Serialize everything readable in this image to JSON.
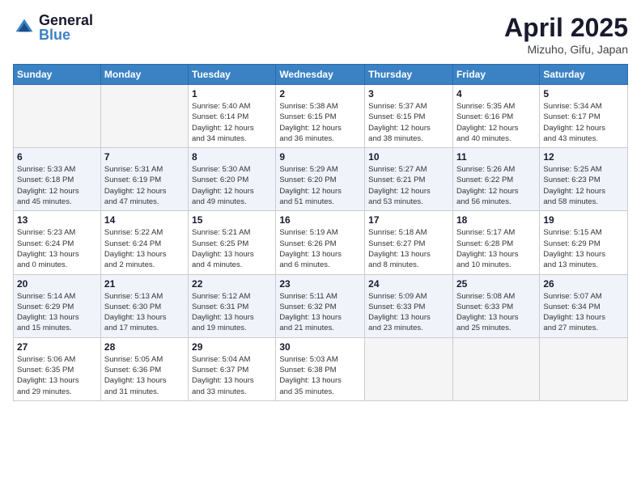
{
  "logo": {
    "general": "General",
    "blue": "Blue"
  },
  "title": "April 2025",
  "location": "Mizuho, Gifu, Japan",
  "weekdays": [
    "Sunday",
    "Monday",
    "Tuesday",
    "Wednesday",
    "Thursday",
    "Friday",
    "Saturday"
  ],
  "weeks": [
    [
      {
        "day": "",
        "info": ""
      },
      {
        "day": "",
        "info": ""
      },
      {
        "day": "1",
        "info": "Sunrise: 5:40 AM\nSunset: 6:14 PM\nDaylight: 12 hours\nand 34 minutes."
      },
      {
        "day": "2",
        "info": "Sunrise: 5:38 AM\nSunset: 6:15 PM\nDaylight: 12 hours\nand 36 minutes."
      },
      {
        "day": "3",
        "info": "Sunrise: 5:37 AM\nSunset: 6:15 PM\nDaylight: 12 hours\nand 38 minutes."
      },
      {
        "day": "4",
        "info": "Sunrise: 5:35 AM\nSunset: 6:16 PM\nDaylight: 12 hours\nand 40 minutes."
      },
      {
        "day": "5",
        "info": "Sunrise: 5:34 AM\nSunset: 6:17 PM\nDaylight: 12 hours\nand 43 minutes."
      }
    ],
    [
      {
        "day": "6",
        "info": "Sunrise: 5:33 AM\nSunset: 6:18 PM\nDaylight: 12 hours\nand 45 minutes."
      },
      {
        "day": "7",
        "info": "Sunrise: 5:31 AM\nSunset: 6:19 PM\nDaylight: 12 hours\nand 47 minutes."
      },
      {
        "day": "8",
        "info": "Sunrise: 5:30 AM\nSunset: 6:20 PM\nDaylight: 12 hours\nand 49 minutes."
      },
      {
        "day": "9",
        "info": "Sunrise: 5:29 AM\nSunset: 6:20 PM\nDaylight: 12 hours\nand 51 minutes."
      },
      {
        "day": "10",
        "info": "Sunrise: 5:27 AM\nSunset: 6:21 PM\nDaylight: 12 hours\nand 53 minutes."
      },
      {
        "day": "11",
        "info": "Sunrise: 5:26 AM\nSunset: 6:22 PM\nDaylight: 12 hours\nand 56 minutes."
      },
      {
        "day": "12",
        "info": "Sunrise: 5:25 AM\nSunset: 6:23 PM\nDaylight: 12 hours\nand 58 minutes."
      }
    ],
    [
      {
        "day": "13",
        "info": "Sunrise: 5:23 AM\nSunset: 6:24 PM\nDaylight: 13 hours\nand 0 minutes."
      },
      {
        "day": "14",
        "info": "Sunrise: 5:22 AM\nSunset: 6:24 PM\nDaylight: 13 hours\nand 2 minutes."
      },
      {
        "day": "15",
        "info": "Sunrise: 5:21 AM\nSunset: 6:25 PM\nDaylight: 13 hours\nand 4 minutes."
      },
      {
        "day": "16",
        "info": "Sunrise: 5:19 AM\nSunset: 6:26 PM\nDaylight: 13 hours\nand 6 minutes."
      },
      {
        "day": "17",
        "info": "Sunrise: 5:18 AM\nSunset: 6:27 PM\nDaylight: 13 hours\nand 8 minutes."
      },
      {
        "day": "18",
        "info": "Sunrise: 5:17 AM\nSunset: 6:28 PM\nDaylight: 13 hours\nand 10 minutes."
      },
      {
        "day": "19",
        "info": "Sunrise: 5:15 AM\nSunset: 6:29 PM\nDaylight: 13 hours\nand 13 minutes."
      }
    ],
    [
      {
        "day": "20",
        "info": "Sunrise: 5:14 AM\nSunset: 6:29 PM\nDaylight: 13 hours\nand 15 minutes."
      },
      {
        "day": "21",
        "info": "Sunrise: 5:13 AM\nSunset: 6:30 PM\nDaylight: 13 hours\nand 17 minutes."
      },
      {
        "day": "22",
        "info": "Sunrise: 5:12 AM\nSunset: 6:31 PM\nDaylight: 13 hours\nand 19 minutes."
      },
      {
        "day": "23",
        "info": "Sunrise: 5:11 AM\nSunset: 6:32 PM\nDaylight: 13 hours\nand 21 minutes."
      },
      {
        "day": "24",
        "info": "Sunrise: 5:09 AM\nSunset: 6:33 PM\nDaylight: 13 hours\nand 23 minutes."
      },
      {
        "day": "25",
        "info": "Sunrise: 5:08 AM\nSunset: 6:33 PM\nDaylight: 13 hours\nand 25 minutes."
      },
      {
        "day": "26",
        "info": "Sunrise: 5:07 AM\nSunset: 6:34 PM\nDaylight: 13 hours\nand 27 minutes."
      }
    ],
    [
      {
        "day": "27",
        "info": "Sunrise: 5:06 AM\nSunset: 6:35 PM\nDaylight: 13 hours\nand 29 minutes."
      },
      {
        "day": "28",
        "info": "Sunrise: 5:05 AM\nSunset: 6:36 PM\nDaylight: 13 hours\nand 31 minutes."
      },
      {
        "day": "29",
        "info": "Sunrise: 5:04 AM\nSunset: 6:37 PM\nDaylight: 13 hours\nand 33 minutes."
      },
      {
        "day": "30",
        "info": "Sunrise: 5:03 AM\nSunset: 6:38 PM\nDaylight: 13 hours\nand 35 minutes."
      },
      {
        "day": "",
        "info": ""
      },
      {
        "day": "",
        "info": ""
      },
      {
        "day": "",
        "info": ""
      }
    ]
  ]
}
